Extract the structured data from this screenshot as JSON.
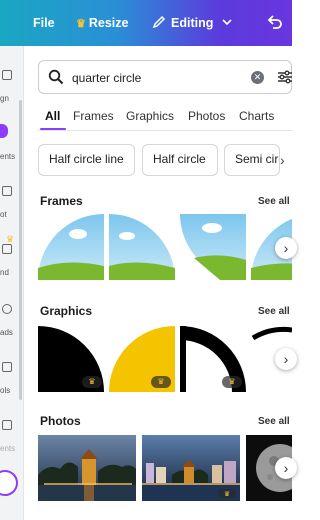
{
  "topbar": {
    "file_label": "File",
    "resize_label": "Resize",
    "editing_label": "Editing"
  },
  "rail": {
    "items": [
      "gn",
      "ents",
      "ot",
      "nd",
      "ads",
      "ols",
      "ents"
    ]
  },
  "search": {
    "query": "quarter circle"
  },
  "tabs": [
    "All",
    "Frames",
    "Graphics",
    "Photos",
    "Charts"
  ],
  "chips": [
    "Half circle line",
    "Half circle",
    "Semi circ"
  ],
  "sections": {
    "frames": {
      "title": "Frames",
      "see_all": "See all"
    },
    "graphics": {
      "title": "Graphics",
      "see_all": "See all"
    },
    "photos": {
      "title": "Photos",
      "see_all": "See all"
    }
  },
  "colors": {
    "accent": "#8b3dff",
    "crown": "#f4c430",
    "graphic_yellow": "#f5c400"
  }
}
